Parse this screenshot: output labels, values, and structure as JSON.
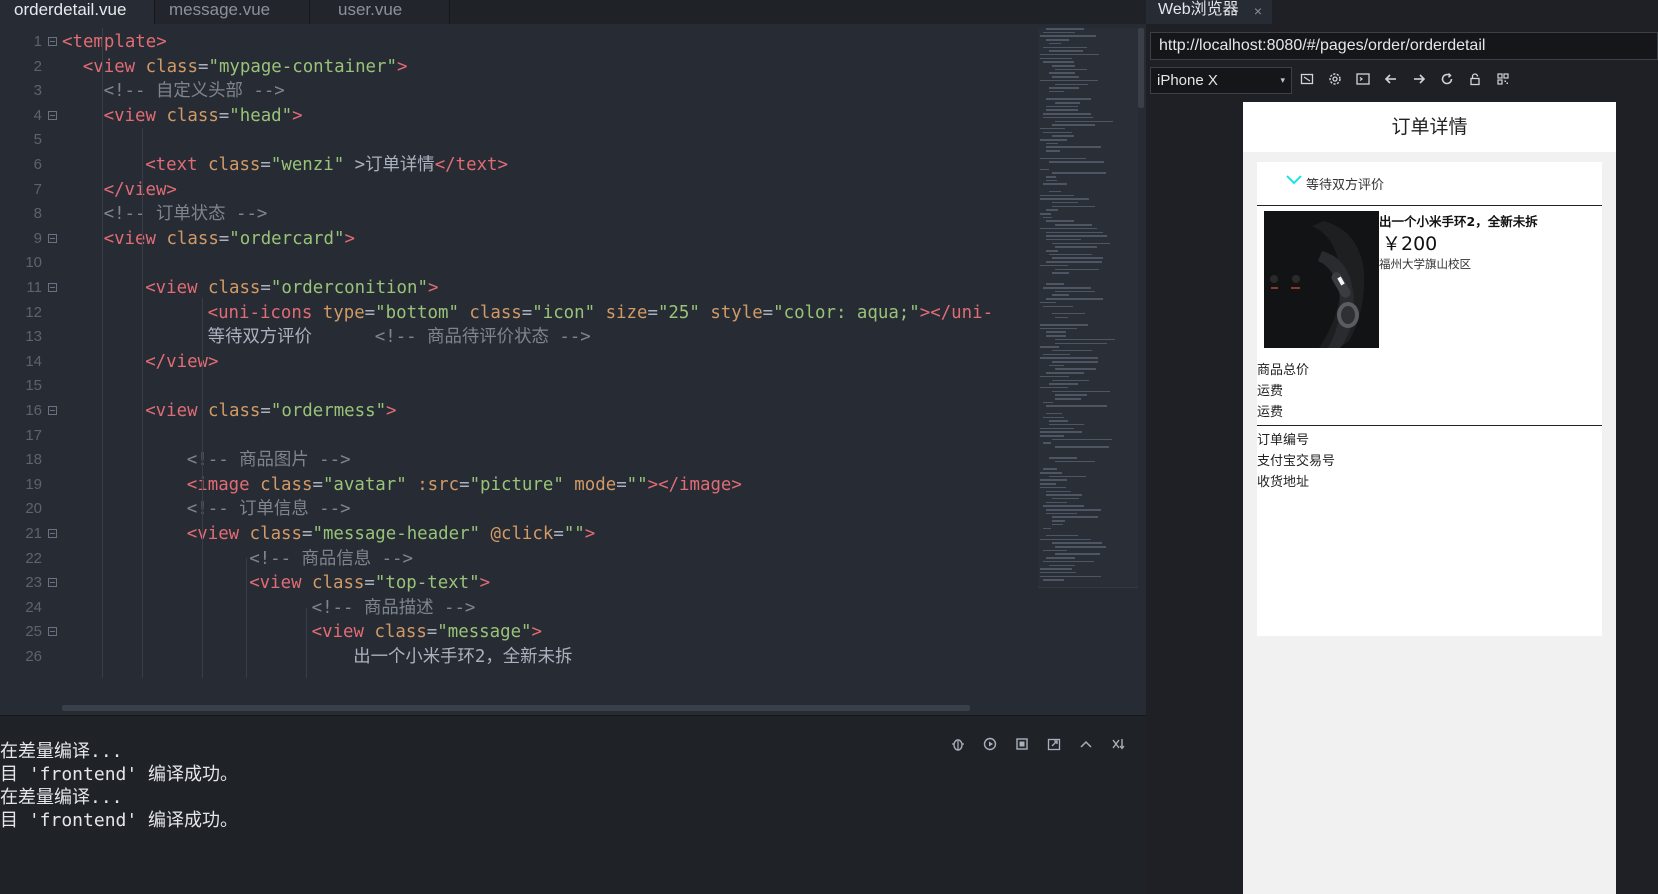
{
  "editor": {
    "tabs": [
      "orderdetail.vue",
      "message.vue",
      "user.vue"
    ],
    "active_tab_index": 0,
    "lines": [
      {
        "n": "1",
        "fold": true,
        "indent": 0,
        "tokens": [
          [
            "t-tag",
            "<template>"
          ]
        ]
      },
      {
        "n": "2",
        "fold": false,
        "indent": 1,
        "tokens": [
          [
            "t-tag",
            "<view"
          ],
          [
            "t-txt",
            " "
          ],
          [
            "t-attr",
            "class"
          ],
          [
            "t-pun",
            "="
          ],
          [
            "t-str",
            "\"mypage-container\""
          ],
          [
            "t-tag",
            ">"
          ]
        ]
      },
      {
        "n": "3",
        "fold": false,
        "indent": 2,
        "tokens": [
          [
            "t-cmt",
            "<!-- 自定义头部 -->"
          ]
        ]
      },
      {
        "n": "4",
        "fold": true,
        "indent": 2,
        "tokens": [
          [
            "t-tag",
            "<view"
          ],
          [
            "t-txt",
            " "
          ],
          [
            "t-attr",
            "class"
          ],
          [
            "t-pun",
            "="
          ],
          [
            "t-str",
            "\"head\""
          ],
          [
            "t-tag",
            ">"
          ]
        ]
      },
      {
        "n": "5",
        "fold": false,
        "indent": 0,
        "tokens": []
      },
      {
        "n": "6",
        "fold": false,
        "indent": 4,
        "tokens": [
          [
            "t-tag",
            "<text"
          ],
          [
            "t-txt",
            " "
          ],
          [
            "t-attr",
            "class"
          ],
          [
            "t-pun",
            "="
          ],
          [
            "t-str",
            "\"wenzi\""
          ],
          [
            "t-txt",
            " >订单详情"
          ],
          [
            "t-tag",
            "</text>"
          ]
        ]
      },
      {
        "n": "7",
        "fold": false,
        "indent": 2,
        "tokens": [
          [
            "t-tag",
            "</view>"
          ]
        ]
      },
      {
        "n": "8",
        "fold": false,
        "indent": 2,
        "tokens": [
          [
            "t-cmt",
            "<!-- 订单状态 -->"
          ]
        ]
      },
      {
        "n": "9",
        "fold": true,
        "indent": 2,
        "tokens": [
          [
            "t-tag",
            "<view"
          ],
          [
            "t-txt",
            " "
          ],
          [
            "t-attr",
            "class"
          ],
          [
            "t-pun",
            "="
          ],
          [
            "t-str",
            "\"ordercard\""
          ],
          [
            "t-tag",
            ">"
          ]
        ]
      },
      {
        "n": "10",
        "fold": false,
        "indent": 0,
        "tokens": []
      },
      {
        "n": "11",
        "fold": true,
        "indent": 4,
        "tokens": [
          [
            "t-tag",
            "<view"
          ],
          [
            "t-txt",
            " "
          ],
          [
            "t-attr",
            "class"
          ],
          [
            "t-pun",
            "="
          ],
          [
            "t-str",
            "\"orderconition\""
          ],
          [
            "t-tag",
            ">"
          ]
        ]
      },
      {
        "n": "12",
        "fold": false,
        "indent": 7,
        "tokens": [
          [
            "t-tag",
            "<uni-icons"
          ],
          [
            "t-txt",
            " "
          ],
          [
            "t-attr",
            "type"
          ],
          [
            "t-pun",
            "="
          ],
          [
            "t-str",
            "\"bottom\""
          ],
          [
            "t-txt",
            " "
          ],
          [
            "t-attr",
            "class"
          ],
          [
            "t-pun",
            "="
          ],
          [
            "t-str",
            "\"icon\""
          ],
          [
            "t-txt",
            " "
          ],
          [
            "t-attr",
            "size"
          ],
          [
            "t-pun",
            "="
          ],
          [
            "t-str",
            "\"25\""
          ],
          [
            "t-txt",
            " "
          ],
          [
            "t-attr",
            "style"
          ],
          [
            "t-pun",
            "="
          ],
          [
            "t-str",
            "\"color: aqua;\""
          ],
          [
            "t-tag",
            "></uni-"
          ]
        ]
      },
      {
        "n": "13",
        "fold": false,
        "indent": 7,
        "tokens": [
          [
            "t-txt",
            "等待双方评价      "
          ],
          [
            "t-cmt",
            "<!-- 商品待评价状态 -->"
          ]
        ]
      },
      {
        "n": "14",
        "fold": false,
        "indent": 4,
        "tokens": [
          [
            "t-tag",
            "</view>"
          ]
        ]
      },
      {
        "n": "15",
        "fold": false,
        "indent": 0,
        "tokens": []
      },
      {
        "n": "16",
        "fold": true,
        "indent": 4,
        "tokens": [
          [
            "t-tag",
            "<view"
          ],
          [
            "t-txt",
            " "
          ],
          [
            "t-attr",
            "class"
          ],
          [
            "t-pun",
            "="
          ],
          [
            "t-str",
            "\"ordermess\""
          ],
          [
            "t-tag",
            ">"
          ]
        ]
      },
      {
        "n": "17",
        "fold": false,
        "indent": 0,
        "tokens": []
      },
      {
        "n": "18",
        "fold": false,
        "indent": 6,
        "tokens": [
          [
            "t-cmt",
            "<!-- 商品图片 -->"
          ]
        ]
      },
      {
        "n": "19",
        "fold": false,
        "indent": 6,
        "tokens": [
          [
            "t-tag",
            "<image"
          ],
          [
            "t-txt",
            " "
          ],
          [
            "t-attr",
            "class"
          ],
          [
            "t-pun",
            "="
          ],
          [
            "t-str",
            "\"avatar\""
          ],
          [
            "t-txt",
            " "
          ],
          [
            "t-attr",
            ":src"
          ],
          [
            "t-pun",
            "="
          ],
          [
            "t-str",
            "\"picture\""
          ],
          [
            "t-txt",
            " "
          ],
          [
            "t-attr",
            "mode"
          ],
          [
            "t-pun",
            "="
          ],
          [
            "t-str",
            "\"\""
          ],
          [
            "t-tag",
            "></image>"
          ]
        ]
      },
      {
        "n": "20",
        "fold": false,
        "indent": 6,
        "tokens": [
          [
            "t-cmt",
            "<!-- 订单信息 -->"
          ]
        ]
      },
      {
        "n": "21",
        "fold": true,
        "indent": 6,
        "tokens": [
          [
            "t-tag",
            "<view"
          ],
          [
            "t-txt",
            " "
          ],
          [
            "t-attr",
            "class"
          ],
          [
            "t-pun",
            "="
          ],
          [
            "t-str",
            "\"message-header\""
          ],
          [
            "t-txt",
            " "
          ],
          [
            "t-attr",
            "@click"
          ],
          [
            "t-pun",
            "="
          ],
          [
            "t-str",
            "\"\""
          ],
          [
            "t-tag",
            ">"
          ]
        ]
      },
      {
        "n": "22",
        "fold": false,
        "indent": 9,
        "tokens": [
          [
            "t-cmt",
            "<!-- 商品信息 -->"
          ]
        ]
      },
      {
        "n": "23",
        "fold": true,
        "indent": 9,
        "tokens": [
          [
            "t-tag",
            "<view"
          ],
          [
            "t-txt",
            " "
          ],
          [
            "t-attr",
            "class"
          ],
          [
            "t-pun",
            "="
          ],
          [
            "t-str",
            "\"top-text\""
          ],
          [
            "t-tag",
            ">"
          ]
        ]
      },
      {
        "n": "24",
        "fold": false,
        "indent": 12,
        "tokens": [
          [
            "t-cmt",
            "<!-- 商品描述 -->"
          ]
        ]
      },
      {
        "n": "25",
        "fold": true,
        "indent": 12,
        "tokens": [
          [
            "t-tag",
            "<view"
          ],
          [
            "t-txt",
            " "
          ],
          [
            "t-attr",
            "class"
          ],
          [
            "t-pun",
            "="
          ],
          [
            "t-str",
            "\"message\""
          ],
          [
            "t-tag",
            ">"
          ]
        ]
      },
      {
        "n": "26",
        "fold": false,
        "indent": 14,
        "tokens": [
          [
            "t-txt",
            "出一个小米手环2，全新未拆"
          ]
        ]
      }
    ]
  },
  "console": {
    "lines": [
      "在差量编译...",
      "目 'frontend' 编译成功。",
      "在差量编译...",
      "目 'frontend' 编译成功。"
    ],
    "tools": [
      "debug-icon",
      "rerun-icon",
      "stop-icon",
      "open-external-icon",
      "collapse-up-icon",
      "clear-icon"
    ]
  },
  "browser": {
    "tab_title": "Web浏览器",
    "close_glyph": "×",
    "url": "http://localhost:8080/#/pages/order/orderdetail",
    "device": "iPhone X",
    "device_caret": "▾"
  },
  "phone": {
    "header_title": "订单详情",
    "status": "等待双方评价",
    "status_icon_color": "#00e5ee",
    "product_title": "出一个小米手环2，全新未拆",
    "price": "￥200",
    "location": "福州大学旗山校区",
    "summary": [
      "商品总价",
      "运费",
      "运费"
    ],
    "order_info": [
      "订单编号",
      "支付宝交易号",
      "收货地址"
    ]
  }
}
